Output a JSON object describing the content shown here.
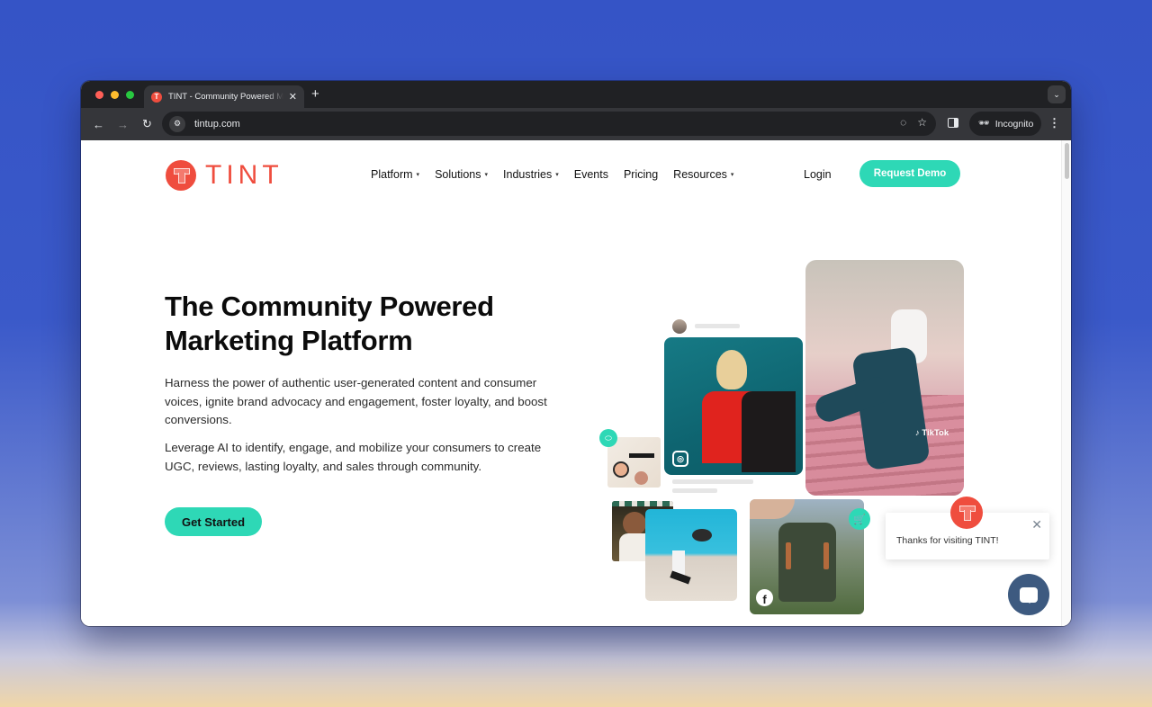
{
  "browser": {
    "tab_title": "TINT - Community Powered Marketing Platform",
    "tab_favicon": "T",
    "new_tab_label": "+",
    "url": "tintup.com",
    "profile_label": "Incognito",
    "icons": {
      "back": "←",
      "forward": "→",
      "reload": "↻",
      "site_info": "⚙",
      "eye_off": "◌",
      "star": "☆",
      "menu": "⋮",
      "tab_menu": "⌄",
      "close": "✕",
      "incognito": "🕶"
    }
  },
  "site": {
    "logo_text": "TINT",
    "brand_color": "#ef4d3e",
    "accent_color": "#2ed8b6",
    "nav": [
      {
        "label": "Platform",
        "dropdown": true
      },
      {
        "label": "Solutions",
        "dropdown": true
      },
      {
        "label": "Industries",
        "dropdown": true
      },
      {
        "label": "Events",
        "dropdown": false
      },
      {
        "label": "Pricing",
        "dropdown": false
      },
      {
        "label": "Resources",
        "dropdown": true
      }
    ],
    "caret": "▾",
    "login_label": "Login",
    "demo_label": "Request Demo"
  },
  "hero": {
    "title": "The Community Powered Marketing Platform",
    "paragraph_1": "Harness the power of authentic user-generated content and consumer voices, ignite brand advocacy and engagement, foster loyalty, and boost conversions.",
    "paragraph_2": "Leverage AI to identify, engage, and mobilize your consumers to create UGC, reviews, lasting loyalty, and sales through community.",
    "cta_label": "Get Started"
  },
  "collage": {
    "tiktok_label": "♪ TikTok",
    "instagram_icon": "◎",
    "facebook_icon": "f",
    "cart_icon": "🛒",
    "tag_icon": "⬭"
  },
  "chat": {
    "message": "Thanks for visiting TINT!",
    "close_icon": "✕"
  }
}
